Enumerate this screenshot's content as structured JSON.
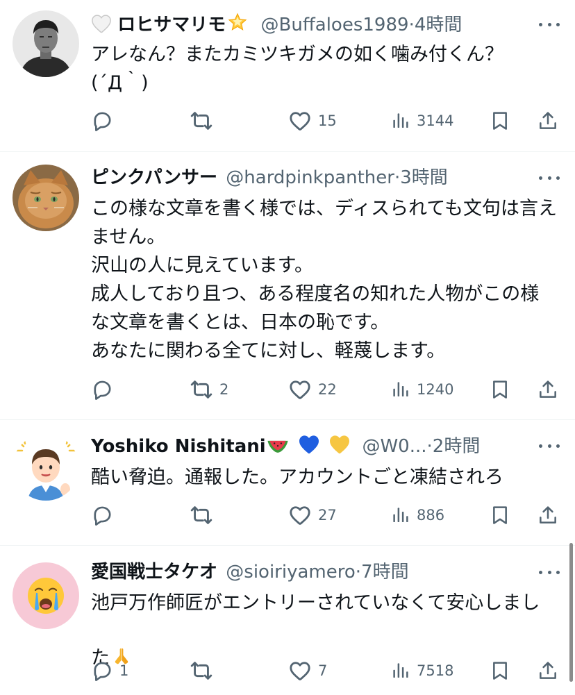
{
  "tweets": [
    {
      "name": "ロヒサマリモ",
      "handle": "@Buffaloes1989",
      "sep": "·",
      "time": "4時間",
      "text": "アレなん？またカミツキガメの如く噛み付くん？\n(´Д｀)",
      "replies": "",
      "retweets": "",
      "likes": "15",
      "views": "3144"
    },
    {
      "name": "ピンクパンサー",
      "handle": "@hardpinkpanther",
      "sep": "·",
      "time": "3時間",
      "text": "この様な文章を書く様では、ディスられても文句は言えません。\n沢山の人に見えています。\n成人しており且つ、ある程度名の知れた人物がこの様な文章を書くとは、日本の恥です。\nあなたに関わる全てに対し、軽蔑します。",
      "replies": "",
      "retweets": "2",
      "likes": "22",
      "views": "1240"
    },
    {
      "name": "Yoshiko Nishitani",
      "handle": "@W0...",
      "sep": "·",
      "time": "2時間",
      "text": "酷い脅迫。通報した。アカウントごと凍結されろ",
      "replies": "",
      "retweets": "",
      "likes": "27",
      "views": "886"
    },
    {
      "name": "愛国戦士タケオ",
      "handle": "@sioiriyamero",
      "sep": "·",
      "time": "7時間",
      "text": "池戸万作師匠がエントリーされていなくて安心しました",
      "replies": "1",
      "retweets": "",
      "likes": "7",
      "views": "7518"
    }
  ],
  "icons": {
    "reply": "reply-icon",
    "retweet": "retweet-icon",
    "like": "like-icon",
    "views": "views-icon",
    "bookmark": "bookmark-icon",
    "share": "share-icon",
    "more": "more-icon"
  },
  "colors": {
    "text": "#0f1419",
    "secondary": "#536471",
    "divider": "#eff3f4"
  }
}
